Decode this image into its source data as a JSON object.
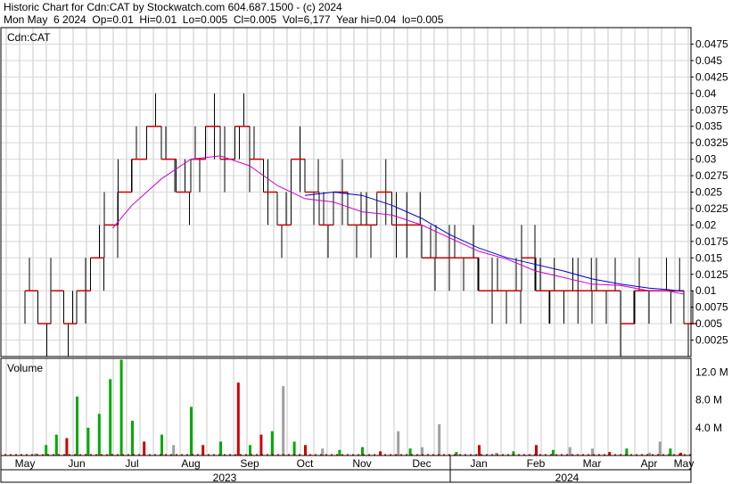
{
  "header": {
    "line1": "Historic Chart for Cdn:CAT by Stockwatch.com 604.687.1500 - (c) 2024",
    "line2": "Mon May  6 2024  Op=0.01  Hi=0.01  Lo=0.005  Cl=0.005  Vol=6,177  Year hi=0.04  lo=0.005"
  },
  "chart_data": [
    {
      "type": "line",
      "title": "Cdn:CAT",
      "ylim": [
        0,
        0.05
      ],
      "y_ticks": [
        "0.0475",
        "0.045",
        "0.0425",
        "0.04",
        "0.0375",
        "0.035",
        "0.0325",
        "0.03",
        "0.0275",
        "0.025",
        "0.0225",
        "0.02",
        "0.0175",
        "0.015",
        "0.0125",
        "0.01",
        "0.0075",
        "0.005",
        "0.0025"
      ],
      "x_ticks": [
        "May",
        "Jun",
        "Jul",
        "Aug",
        "Sep",
        "Oct",
        "Nov",
        "Dec",
        "Jan",
        "Feb",
        "Mar",
        "Apr",
        "May"
      ],
      "years": [
        "2023",
        "2024"
      ],
      "colors": {
        "price": "#000000",
        "close": "#cc0000",
        "ma_short": "#cc00cc",
        "ma_long": "#0000cc"
      },
      "price_levels": [
        {
          "x": 0.0,
          "close": 0.01
        },
        {
          "x": 0.25,
          "close": 0.005
        },
        {
          "x": 0.5,
          "close": 0.01
        },
        {
          "x": 0.75,
          "close": 0.005
        },
        {
          "x": 1.0,
          "close": 0.01
        },
        {
          "x": 1.25,
          "close": 0.015
        },
        {
          "x": 1.5,
          "close": 0.02
        },
        {
          "x": 1.75,
          "close": 0.025
        },
        {
          "x": 2.0,
          "close": 0.03
        },
        {
          "x": 2.25,
          "close": 0.035
        },
        {
          "x": 2.5,
          "close": 0.03
        },
        {
          "x": 2.75,
          "close": 0.025
        },
        {
          "x": 3.0,
          "close": 0.03
        },
        {
          "x": 3.25,
          "close": 0.035
        },
        {
          "x": 3.5,
          "close": 0.03
        },
        {
          "x": 3.75,
          "close": 0.035
        },
        {
          "x": 4.0,
          "close": 0.03
        },
        {
          "x": 4.25,
          "close": 0.025
        },
        {
          "x": 4.5,
          "close": 0.02
        },
        {
          "x": 4.75,
          "close": 0.03
        },
        {
          "x": 5.0,
          "close": 0.025
        },
        {
          "x": 5.25,
          "close": 0.02
        },
        {
          "x": 5.5,
          "close": 0.025
        },
        {
          "x": 5.75,
          "close": 0.02
        },
        {
          "x": 6.0,
          "close": 0.02
        },
        {
          "x": 6.25,
          "close": 0.025
        },
        {
          "x": 6.5,
          "close": 0.02
        },
        {
          "x": 6.75,
          "close": 0.02
        },
        {
          "x": 7.0,
          "close": 0.015
        },
        {
          "x": 7.25,
          "close": 0.015
        },
        {
          "x": 7.5,
          "close": 0.015
        },
        {
          "x": 7.75,
          "close": 0.015
        },
        {
          "x": 8.0,
          "close": 0.01
        },
        {
          "x": 8.25,
          "close": 0.01
        },
        {
          "x": 8.5,
          "close": 0.01
        },
        {
          "x": 8.75,
          "close": 0.015
        },
        {
          "x": 9.0,
          "close": 0.01
        },
        {
          "x": 9.25,
          "close": 0.01
        },
        {
          "x": 9.5,
          "close": 0.01
        },
        {
          "x": 9.75,
          "close": 0.01
        },
        {
          "x": 10.0,
          "close": 0.01
        },
        {
          "x": 10.25,
          "close": 0.01
        },
        {
          "x": 10.5,
          "close": 0.005
        },
        {
          "x": 10.75,
          "close": 0.01
        },
        {
          "x": 11.0,
          "close": 0.01
        },
        {
          "x": 11.25,
          "close": 0.01
        },
        {
          "x": 11.5,
          "close": 0.01
        },
        {
          "x": 11.75,
          "close": 0.01
        },
        {
          "x": 12.0,
          "close": 0.005
        }
      ],
      "ma_short": [
        {
          "x": 1.65,
          "y": 0.0195
        },
        {
          "x": 2.0,
          "y": 0.023
        },
        {
          "x": 2.5,
          "y": 0.027
        },
        {
          "x": 3.0,
          "y": 0.03
        },
        {
          "x": 3.5,
          "y": 0.0305
        },
        {
          "x": 4.0,
          "y": 0.029
        },
        {
          "x": 4.5,
          "y": 0.026
        },
        {
          "x": 5.0,
          "y": 0.024
        },
        {
          "x": 5.5,
          "y": 0.0235
        },
        {
          "x": 6.0,
          "y": 0.022
        },
        {
          "x": 6.5,
          "y": 0.0215
        },
        {
          "x": 7.0,
          "y": 0.02
        },
        {
          "x": 7.5,
          "y": 0.018
        },
        {
          "x": 8.0,
          "y": 0.016
        },
        {
          "x": 8.5,
          "y": 0.0148
        },
        {
          "x": 9.0,
          "y": 0.013
        },
        {
          "x": 9.5,
          "y": 0.012
        },
        {
          "x": 10.0,
          "y": 0.011
        },
        {
          "x": 10.5,
          "y": 0.0108
        },
        {
          "x": 11.0,
          "y": 0.01
        },
        {
          "x": 11.5,
          "y": 0.01
        },
        {
          "x": 12.0,
          "y": 0.0095
        }
      ],
      "ma_long": [
        {
          "x": 5.0,
          "y": 0.0245
        },
        {
          "x": 5.5,
          "y": 0.025
        },
        {
          "x": 6.0,
          "y": 0.0245
        },
        {
          "x": 6.5,
          "y": 0.023
        },
        {
          "x": 7.0,
          "y": 0.021
        },
        {
          "x": 7.5,
          "y": 0.0185
        },
        {
          "x": 8.0,
          "y": 0.0165
        },
        {
          "x": 8.5,
          "y": 0.015
        },
        {
          "x": 9.0,
          "y": 0.014
        },
        {
          "x": 9.5,
          "y": 0.013
        },
        {
          "x": 10.0,
          "y": 0.0118
        },
        {
          "x": 10.5,
          "y": 0.011
        },
        {
          "x": 11.0,
          "y": 0.0104
        },
        {
          "x": 11.5,
          "y": 0.0102
        },
        {
          "x": 12.0,
          "y": 0.0099
        }
      ]
    },
    {
      "type": "bar",
      "title": "Volume",
      "ylim": [
        0,
        14000000
      ],
      "y_ticks": [
        "12.0 M",
        "8.0 M",
        "4.0 M"
      ],
      "colors": {
        "up": "#00aa00",
        "down": "#cc0000",
        "flat": "#a0a0a0"
      },
      "bars": [
        {
          "x": 0.2,
          "v": 0.3,
          "c": "flat"
        },
        {
          "x": 0.4,
          "v": 1.5,
          "c": "up"
        },
        {
          "x": 0.6,
          "v": 3.0,
          "c": "up"
        },
        {
          "x": 0.8,
          "v": 2.5,
          "c": "down"
        },
        {
          "x": 1.0,
          "v": 8.5,
          "c": "up"
        },
        {
          "x": 1.2,
          "v": 4.0,
          "c": "up"
        },
        {
          "x": 1.4,
          "v": 6.0,
          "c": "up"
        },
        {
          "x": 1.6,
          "v": 11.0,
          "c": "up"
        },
        {
          "x": 1.8,
          "v": 13.8,
          "c": "up"
        },
        {
          "x": 2.0,
          "v": 5.0,
          "c": "up"
        },
        {
          "x": 2.2,
          "v": 2.0,
          "c": "down"
        },
        {
          "x": 2.5,
          "v": 3.0,
          "c": "up"
        },
        {
          "x": 2.7,
          "v": 1.5,
          "c": "flat"
        },
        {
          "x": 3.0,
          "v": 7.0,
          "c": "up"
        },
        {
          "x": 3.2,
          "v": 1.5,
          "c": "down"
        },
        {
          "x": 3.5,
          "v": 2.0,
          "c": "up"
        },
        {
          "x": 3.8,
          "v": 10.5,
          "c": "down"
        },
        {
          "x": 4.0,
          "v": 1.5,
          "c": "up"
        },
        {
          "x": 4.2,
          "v": 3.0,
          "c": "down"
        },
        {
          "x": 4.4,
          "v": 3.5,
          "c": "up"
        },
        {
          "x": 4.6,
          "v": 10.0,
          "c": "flat"
        },
        {
          "x": 4.8,
          "v": 2.0,
          "c": "up"
        },
        {
          "x": 5.0,
          "v": 1.5,
          "c": "down"
        },
        {
          "x": 5.3,
          "v": 1.0,
          "c": "flat"
        },
        {
          "x": 5.6,
          "v": 0.8,
          "c": "up"
        },
        {
          "x": 6.0,
          "v": 1.2,
          "c": "up"
        },
        {
          "x": 6.3,
          "v": 0.6,
          "c": "down"
        },
        {
          "x": 6.6,
          "v": 3.5,
          "c": "flat"
        },
        {
          "x": 6.8,
          "v": 1.0,
          "c": "up"
        },
        {
          "x": 7.0,
          "v": 1.2,
          "c": "flat"
        },
        {
          "x": 7.3,
          "v": 4.5,
          "c": "flat"
        },
        {
          "x": 7.6,
          "v": 0.5,
          "c": "up"
        },
        {
          "x": 8.0,
          "v": 1.5,
          "c": "down"
        },
        {
          "x": 8.3,
          "v": 0.4,
          "c": "flat"
        },
        {
          "x": 8.6,
          "v": 0.6,
          "c": "up"
        },
        {
          "x": 9.0,
          "v": 1.5,
          "c": "down"
        },
        {
          "x": 9.3,
          "v": 0.8,
          "c": "up"
        },
        {
          "x": 9.6,
          "v": 1.2,
          "c": "flat"
        },
        {
          "x": 10.0,
          "v": 1.0,
          "c": "flat"
        },
        {
          "x": 10.3,
          "v": 0.5,
          "c": "down"
        },
        {
          "x": 10.6,
          "v": 1.0,
          "c": "up"
        },
        {
          "x": 11.0,
          "v": 0.4,
          "c": "flat"
        },
        {
          "x": 11.3,
          "v": 2.0,
          "c": "flat"
        },
        {
          "x": 11.6,
          "v": 1.0,
          "c": "up"
        },
        {
          "x": 11.9,
          "v": 0.4,
          "c": "down"
        }
      ]
    }
  ]
}
